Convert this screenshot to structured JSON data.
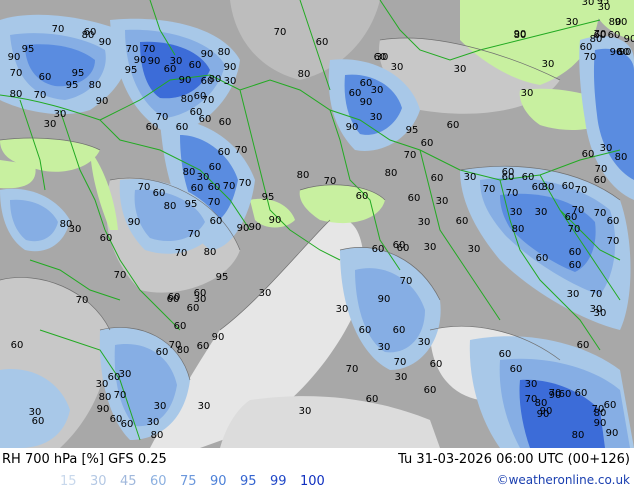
{
  "footer": {
    "title": "RH 700 hPa [%] GFS 0.25",
    "datetime": "Tu 31-03-2026 06:00 UTC (00+126)",
    "credit": "©weatheronline.co.uk",
    "legend": [
      {
        "label": "15",
        "color": "#c8d8ec"
      },
      {
        "label": "30",
        "color": "#b4c8e4"
      },
      {
        "label": "45",
        "color": "#a0b8dc"
      },
      {
        "label": "60",
        "color": "#8cb0e0"
      },
      {
        "label": "75",
        "color": "#6c98dc"
      },
      {
        "label": "90",
        "color": "#4c80d8"
      },
      {
        "label": "95",
        "color": "#3464d0"
      },
      {
        "label": "99",
        "color": "#2048c8"
      },
      {
        "label": "100",
        "color": "#1030c0"
      }
    ]
  },
  "map": {
    "colors": {
      "background": "#a8a8a8",
      "dry_light": "#e6e6e6",
      "dry_mid": "#c8c8c8",
      "green_low": "#c8f0a0",
      "rh_60": "#a8c8e8",
      "rh_75": "#86aee4",
      "rh_90": "#5a8ce0",
      "rh_95": "#3c6cd8",
      "border": "#22aa22",
      "contour": "#707070"
    },
    "contour_labels": [
      {
        "text": "60"
      },
      {
        "text": "30"
      },
      {
        "text": "30"
      },
      {
        "text": "60"
      },
      {
        "text": "90"
      },
      {
        "text": "90"
      },
      {
        "text": "60"
      },
      {
        "text": "80"
      },
      {
        "text": "95"
      },
      {
        "text": "80"
      },
      {
        "text": "95"
      },
      {
        "text": "90"
      },
      {
        "text": "70"
      },
      {
        "text": "60"
      },
      {
        "text": "95"
      },
      {
        "text": "95"
      },
      {
        "text": "80"
      },
      {
        "text": "90"
      },
      {
        "text": "80"
      },
      {
        "text": "70"
      },
      {
        "text": "70"
      },
      {
        "text": "80"
      },
      {
        "text": "90"
      },
      {
        "text": "70"
      },
      {
        "text": "70"
      },
      {
        "text": "90"
      },
      {
        "text": "30"
      },
      {
        "text": "60"
      },
      {
        "text": "90"
      },
      {
        "text": "80"
      },
      {
        "text": "60"
      },
      {
        "text": "80"
      },
      {
        "text": "90"
      },
      {
        "text": "60"
      },
      {
        "text": "90"
      },
      {
        "text": "60"
      },
      {
        "text": "30"
      },
      {
        "text": "70"
      },
      {
        "text": "60"
      },
      {
        "text": "80"
      },
      {
        "text": "95"
      },
      {
        "text": "90"
      },
      {
        "text": "70"
      },
      {
        "text": "60"
      },
      {
        "text": "80"
      },
      {
        "text": "60"
      },
      {
        "text": "60"
      },
      {
        "text": "70"
      },
      {
        "text": "60"
      },
      {
        "text": "60"
      },
      {
        "text": "30"
      },
      {
        "text": "30"
      },
      {
        "text": "30"
      },
      {
        "text": "30"
      },
      {
        "text": "60"
      },
      {
        "text": "30"
      },
      {
        "text": "30"
      },
      {
        "text": "80"
      },
      {
        "text": "70"
      },
      {
        "text": "90"
      },
      {
        "text": "90"
      },
      {
        "text": "60"
      },
      {
        "text": "60"
      },
      {
        "text": "70"
      },
      {
        "text": "90"
      },
      {
        "text": "30"
      },
      {
        "text": "60"
      },
      {
        "text": "30"
      },
      {
        "text": "60"
      },
      {
        "text": "30"
      },
      {
        "text": "90"
      },
      {
        "text": "30"
      },
      {
        "text": "90"
      },
      {
        "text": "95"
      },
      {
        "text": "60"
      },
      {
        "text": "60"
      },
      {
        "text": "70"
      },
      {
        "text": "80"
      },
      {
        "text": "60"
      },
      {
        "text": "60"
      },
      {
        "text": "30"
      },
      {
        "text": "30"
      },
      {
        "text": "70"
      },
      {
        "text": "60"
      },
      {
        "text": "60"
      },
      {
        "text": "30"
      },
      {
        "text": "60"
      },
      {
        "text": "70"
      },
      {
        "text": "30"
      },
      {
        "text": "60"
      },
      {
        "text": "80"
      },
      {
        "text": "70"
      },
      {
        "text": "60"
      },
      {
        "text": "60"
      },
      {
        "text": "60"
      },
      {
        "text": "70"
      },
      {
        "text": "30"
      },
      {
        "text": "30"
      },
      {
        "text": "60"
      },
      {
        "text": "70"
      },
      {
        "text": "80"
      },
      {
        "text": "60"
      },
      {
        "text": "70"
      },
      {
        "text": "70"
      },
      {
        "text": "60"
      },
      {
        "text": "70"
      },
      {
        "text": "60"
      },
      {
        "text": "60"
      },
      {
        "text": "30"
      },
      {
        "text": "30"
      },
      {
        "text": "30"
      },
      {
        "text": "60"
      },
      {
        "text": "70"
      },
      {
        "text": "60"
      },
      {
        "text": "70"
      },
      {
        "text": "80"
      },
      {
        "text": "90"
      },
      {
        "text": "60"
      },
      {
        "text": "60"
      },
      {
        "text": "80"
      },
      {
        "text": "90"
      },
      {
        "text": "60"
      },
      {
        "text": "90"
      },
      {
        "text": "30"
      },
      {
        "text": "60"
      },
      {
        "text": "70"
      },
      {
        "text": "90"
      },
      {
        "text": "80"
      },
      {
        "text": "70"
      },
      {
        "text": "90"
      },
      {
        "text": "80"
      },
      {
        "text": "95"
      },
      {
        "text": "90"
      },
      {
        "text": "70"
      },
      {
        "text": "60"
      },
      {
        "text": "30"
      },
      {
        "text": "60"
      },
      {
        "text": "60"
      },
      {
        "text": "60"
      },
      {
        "text": "30"
      },
      {
        "text": "60"
      },
      {
        "text": "30"
      },
      {
        "text": "70"
      },
      {
        "text": "90"
      },
      {
        "text": "60"
      },
      {
        "text": "30"
      },
      {
        "text": "60"
      },
      {
        "text": "70"
      },
      {
        "text": "60"
      },
      {
        "text": "30"
      },
      {
        "text": "60"
      },
      {
        "text": "30"
      },
      {
        "text": "70"
      },
      {
        "text": "30"
      },
      {
        "text": "30"
      },
      {
        "text": "60"
      },
      {
        "text": "30"
      },
      {
        "text": "30"
      },
      {
        "text": "60"
      },
      {
        "text": "60"
      },
      {
        "text": "60"
      },
      {
        "text": "70"
      },
      {
        "text": "80"
      },
      {
        "text": "60"
      },
      {
        "text": "30"
      },
      {
        "text": "30"
      },
      {
        "text": "60"
      },
      {
        "text": "80"
      },
      {
        "text": "90"
      },
      {
        "text": "60"
      },
      {
        "text": "30"
      },
      {
        "text": "30"
      },
      {
        "text": "30"
      },
      {
        "text": "60"
      },
      {
        "text": "70"
      },
      {
        "text": "80"
      },
      {
        "text": "30"
      },
      {
        "text": "60"
      },
      {
        "text": "80"
      },
      {
        "text": "30"
      },
      {
        "text": "60"
      },
      {
        "text": "70"
      },
      {
        "text": "80"
      },
      {
        "text": "70"
      },
      {
        "text": "90"
      },
      {
        "text": "60"
      },
      {
        "text": "70"
      },
      {
        "text": "95"
      },
      {
        "text": "70"
      },
      {
        "text": "60"
      },
      {
        "text": "80"
      },
      {
        "text": "30"
      },
      {
        "text": "60"
      },
      {
        "text": "60"
      },
      {
        "text": "70"
      },
      {
        "text": "70"
      },
      {
        "text": "70"
      },
      {
        "text": "60"
      },
      {
        "text": "60"
      },
      {
        "text": "90"
      },
      {
        "text": "90"
      },
      {
        "text": "80"
      },
      {
        "text": "70"
      },
      {
        "text": "60"
      },
      {
        "text": "60"
      },
      {
        "text": "95"
      },
      {
        "text": "90"
      },
      {
        "text": "60"
      },
      {
        "text": "60"
      },
      {
        "text": "70"
      },
      {
        "text": "30"
      },
      {
        "text": "30"
      },
      {
        "text": "80"
      },
      {
        "text": "60"
      },
      {
        "text": "70"
      },
      {
        "text": "60"
      },
      {
        "text": "30"
      },
      {
        "text": "60"
      }
    ]
  }
}
